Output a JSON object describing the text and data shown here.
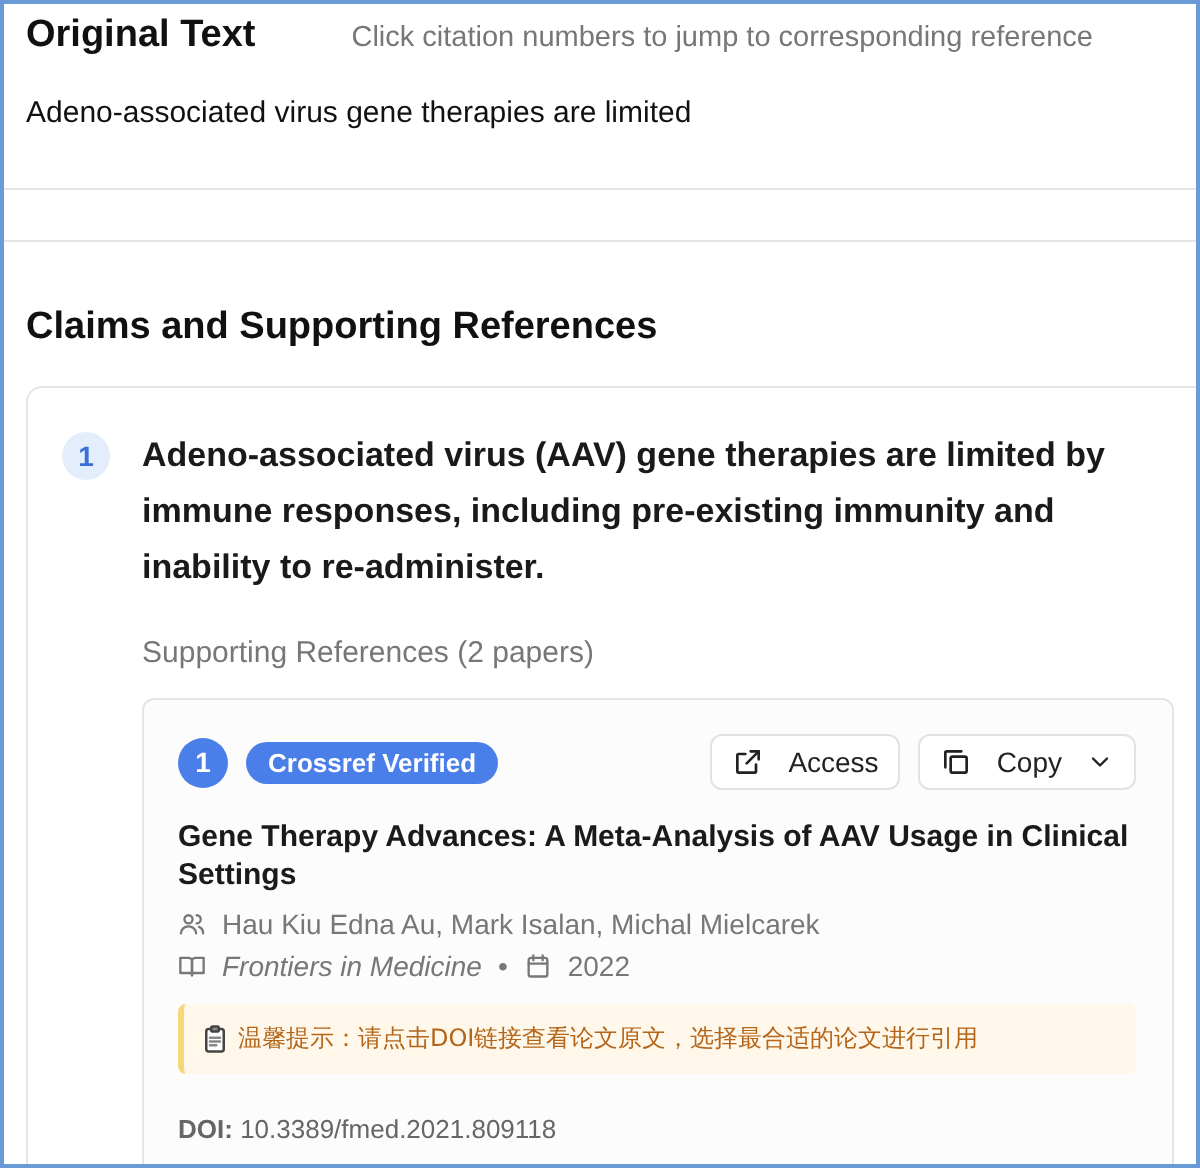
{
  "original_text": {
    "title": "Original Text",
    "hint": "Click citation numbers to jump to corresponding reference",
    "text": "Adeno-associated virus gene therapies are limited"
  },
  "claims_section": {
    "title": "Claims and Supporting References",
    "claims": [
      {
        "number": "1",
        "text": "Adeno-associated virus (AAV) gene therapies are limited by immune responses, including pre-existing immunity and inability to re-administer.",
        "references_heading": "Supporting References (2 papers)",
        "references": [
          {
            "number": "1",
            "badge": "Crossref Verified",
            "access_label": "Access",
            "copy_label": "Copy",
            "title": "Gene Therapy Advances: A Meta-Analysis of AAV Usage in Clinical Settings",
            "authors": "Hau Kiu Edna Au, Mark Isalan, Michal Mielcarek",
            "journal": "Frontiers in Medicine",
            "separator": "•",
            "year": "2022",
            "notice": "温馨提示：请点击DOI链接查看论文原文，选择最合适的论文进行引用",
            "doi_label": "DOI:",
            "doi": "10.3389/fmed.2021.809118"
          }
        ]
      }
    ]
  }
}
